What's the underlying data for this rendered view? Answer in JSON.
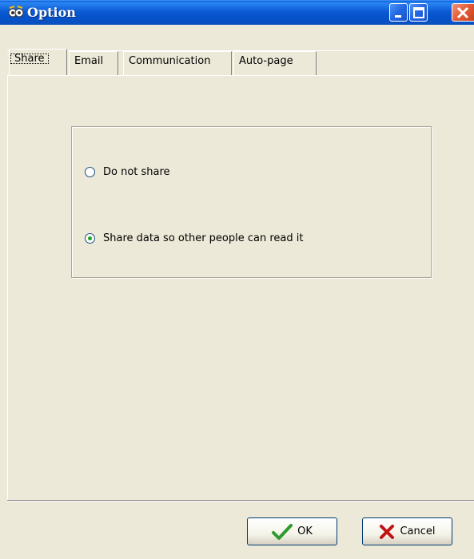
{
  "window": {
    "title": "Option",
    "icon": "app-icon",
    "buttons": [
      "minimize",
      "maximize",
      "close"
    ]
  },
  "tabs": [
    {
      "label": "Share",
      "selected": true
    },
    {
      "label": "Email",
      "selected": false
    },
    {
      "label": "Communication",
      "selected": false
    },
    {
      "label": "Auto-page",
      "selected": false
    }
  ],
  "share": {
    "options": [
      {
        "label": "Do not share",
        "checked": false
      },
      {
        "label": "Share data so other people can read it",
        "checked": true
      }
    ]
  },
  "footer": {
    "ok_label": "OK",
    "cancel_label": "Cancel",
    "ok_icon": "checkmark-icon",
    "cancel_icon": "x-icon",
    "accent_ok": "#2d9a2d",
    "accent_cancel": "#c01515"
  }
}
